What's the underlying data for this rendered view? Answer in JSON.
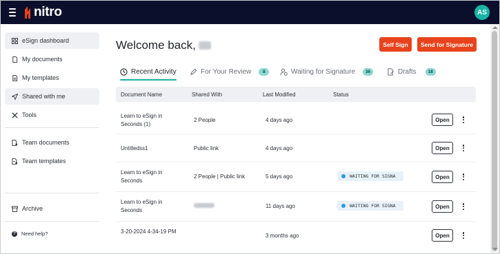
{
  "header": {
    "logo_text": "nitro",
    "avatar_initials": "AS",
    "brand_color": "#e8431c",
    "accent_color": "#17b3a3"
  },
  "sidebar": {
    "items": [
      {
        "label": "eSign dashboard",
        "icon": "grid-icon"
      },
      {
        "label": "My documents",
        "icon": "document-icon"
      },
      {
        "label": "My templates",
        "icon": "template-icon"
      },
      {
        "label": "Shared with me",
        "icon": "send-icon"
      },
      {
        "label": "Tools",
        "icon": "tools-icon"
      },
      {
        "label": "Team documents",
        "icon": "team-document-icon"
      },
      {
        "label": "Team templates",
        "icon": "team-template-icon"
      },
      {
        "label": "Archive",
        "icon": "archive-icon"
      }
    ],
    "help_label": "Need help?"
  },
  "main": {
    "welcome": "Welcome back,",
    "self_sign_label": "Self Sign",
    "send_for_signature_label": "Send for Signature",
    "tabs": [
      {
        "label": "Recent Activity",
        "badge": null
      },
      {
        "label": "For Your Review",
        "badge": "8"
      },
      {
        "label": "Waiting for Signature",
        "badge": "36"
      },
      {
        "label": "Drafts",
        "badge": "18"
      }
    ],
    "table": {
      "headers": [
        "Document Name",
        "Shared With",
        "Last Modified",
        "Status"
      ],
      "rows": [
        {
          "name": "Learn to eSign in Seconds (1)",
          "shared": "2 People",
          "modified": "4 days ago",
          "status": "",
          "action": "Open"
        },
        {
          "name": "Untitledss1",
          "shared": "Public link",
          "modified": "4 days ago",
          "status": "",
          "action": "Open"
        },
        {
          "name": "Learn to eSign in Seconds",
          "shared": "2 People | Public link",
          "modified": "5 days ago",
          "status": "WAITING FOR SIGNA",
          "action": "Open"
        },
        {
          "name": "Learn to eSign in Seconds",
          "shared": "",
          "modified": "11 days ago",
          "status": "WAITING FOR SIGNA",
          "action": "Open"
        },
        {
          "name": "3-20-2024 4-34-19 PM",
          "shared": "",
          "modified": "3 months ago",
          "status": "",
          "action": "Open"
        }
      ]
    }
  }
}
